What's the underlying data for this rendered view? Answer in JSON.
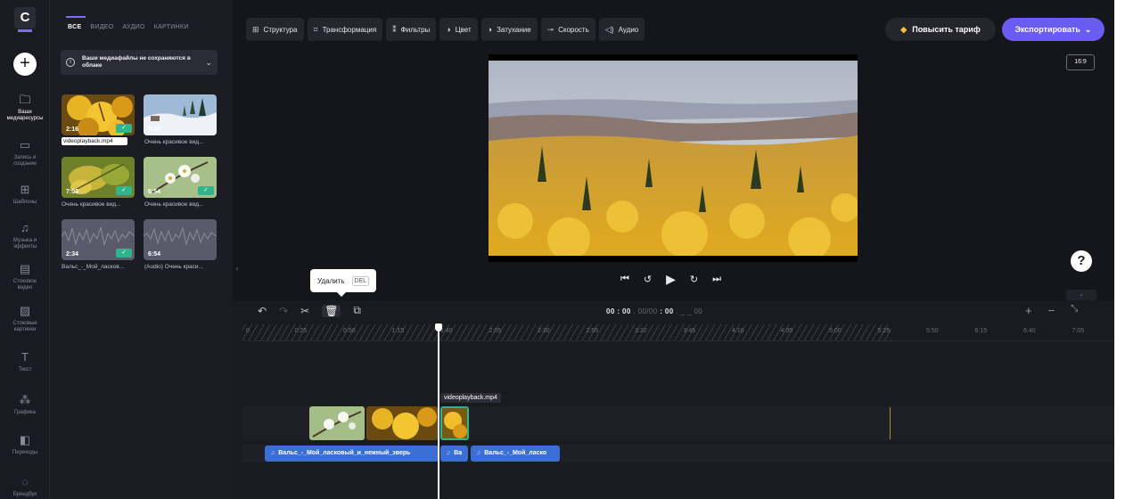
{
  "rail": {
    "logo_letter": "C",
    "items": [
      {
        "icon": "folder-icon",
        "glyph": "🗀",
        "label": "Ваши\nмедиаресурсы",
        "active": true
      },
      {
        "icon": "camera-icon",
        "glyph": "▭",
        "label": "Запись и\nсоздание"
      },
      {
        "icon": "templates-icon",
        "glyph": "⊞",
        "label": "Шаблоны"
      },
      {
        "icon": "music-icon",
        "glyph": "♫",
        "label": "Музыка и\nэффекты"
      },
      {
        "icon": "stock-video-icon",
        "glyph": "▤",
        "label": "Стоковое\nвидео"
      },
      {
        "icon": "stock-images-icon",
        "glyph": "▨",
        "label": "Стоковые\nкартинки"
      },
      {
        "icon": "text-icon",
        "glyph": "T",
        "label": "Текст"
      },
      {
        "icon": "graphics-icon",
        "glyph": "⁂",
        "label": "Графика"
      },
      {
        "icon": "transitions-icon",
        "glyph": "◧",
        "label": "Переходы"
      },
      {
        "icon": "brand-kit-icon",
        "glyph": "◌",
        "label": "Брендбук"
      }
    ]
  },
  "panel": {
    "tabs": [
      "ВСЕ",
      "ВИДЕО",
      "АУДИО",
      "КАРТИНКИ"
    ],
    "notice": "Ваши медиафайлы не сохраняются в облаке",
    "media": [
      {
        "name": "videoplayback.mp4",
        "duration": "2:16",
        "added": true,
        "scene": "leaves"
      },
      {
        "name": "Очень красивое вид...",
        "duration": "5:44",
        "added": false,
        "scene": "snow"
      },
      {
        "name": "Очень красивое вид...",
        "duration": "7:03",
        "added": true,
        "scene": "leaves2"
      },
      {
        "name": "Очень красивое вид...",
        "duration": "6:54",
        "added": true,
        "scene": "flowers"
      },
      {
        "name": "Вальс_-_Мой_ласков...",
        "duration": "2:34",
        "added": true,
        "scene": "audio"
      },
      {
        "name": "(Audio) Очень краси...",
        "duration": "6:54",
        "added": false,
        "scene": "audio"
      }
    ]
  },
  "toolbar": {
    "tools": [
      {
        "icon": "layout-icon",
        "glyph": "⊞",
        "label": "Структура"
      },
      {
        "icon": "transform-icon",
        "glyph": "⌗",
        "label": "Трансформация"
      },
      {
        "icon": "filters-icon",
        "glyph": "⁑",
        "label": "Фильтры"
      },
      {
        "icon": "color-icon",
        "glyph": "◑",
        "label": "Цвет"
      },
      {
        "icon": "fade-icon",
        "glyph": "◑",
        "label": "Затухание"
      },
      {
        "icon": "speed-icon",
        "glyph": "⊸",
        "label": "Скорость"
      },
      {
        "icon": "audio-icon",
        "glyph": "◁)",
        "label": "Аудио"
      }
    ],
    "upgrade": "Повысить тариф",
    "export": "Экспортировать",
    "ratio": "16:9"
  },
  "tooltip": {
    "label": "Удалить",
    "key": "DEL"
  },
  "timeline": {
    "timecode_main": "00 : 00",
    "timecode_frames": ". 00/00",
    "timecode_total": ": 00",
    "timecode_rest": ". _ _ 00",
    "ticks": [
      "0",
      "0:25",
      "0:50",
      "1:15",
      "1:40",
      "2:05",
      "2:30",
      "2:55",
      "3:20",
      "3:45",
      "4:10",
      "4:35",
      "5:00",
      "5:25",
      "5:50",
      "6:15",
      "6:40",
      "7:05"
    ],
    "selected_clip": "videoplayback.mp4",
    "audio_clips": [
      "Вальс_-_Мой_ласковый_и_нежный_зверь",
      "Ва",
      "Вальс_-_Мой_ласко"
    ]
  }
}
